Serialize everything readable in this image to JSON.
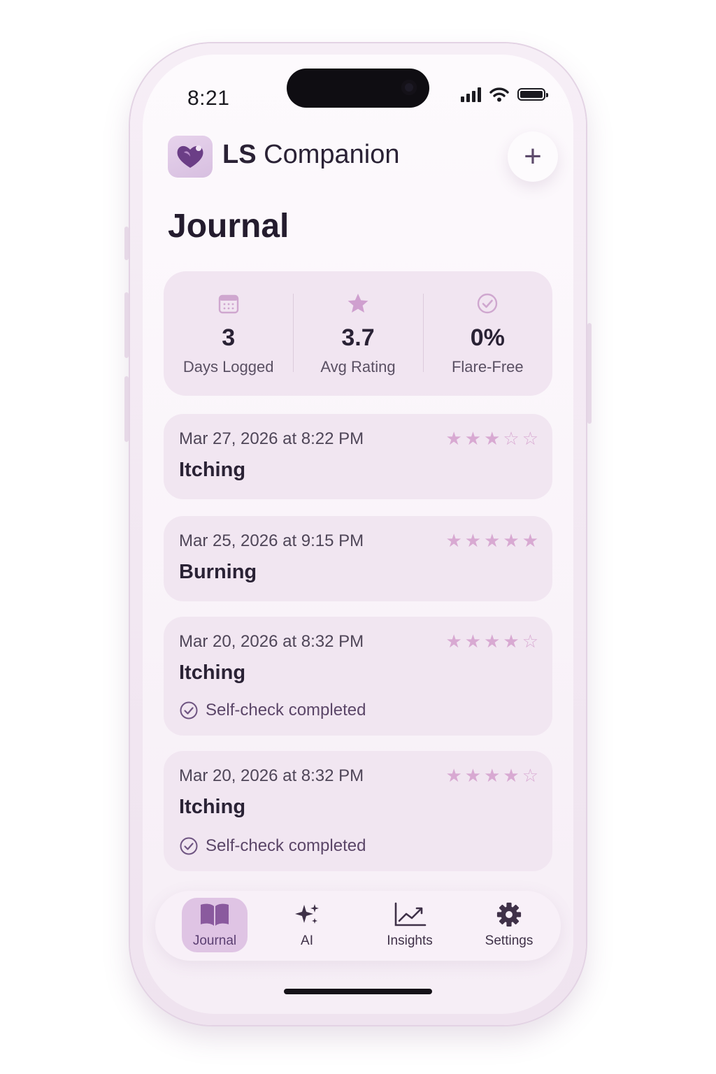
{
  "status_bar": {
    "time": "8:21"
  },
  "header": {
    "app_name_bold": "LS",
    "app_name_rest": "Companion",
    "add_button_label": "+"
  },
  "page": {
    "title": "Journal"
  },
  "stats": [
    {
      "icon": "calendar-icon",
      "value": "3",
      "label": "Days Logged"
    },
    {
      "icon": "star-icon",
      "value": "3.7",
      "label": "Avg Rating"
    },
    {
      "icon": "check-circle-icon",
      "value": "0%",
      "label": "Flare-Free"
    }
  ],
  "entries": [
    {
      "date": "Mar 27, 2026 at 8:22 PM",
      "symptom": "Itching",
      "rating": 3,
      "self_check": ""
    },
    {
      "date": "Mar 25, 2026 at 9:15 PM",
      "symptom": "Burning",
      "rating": 5,
      "self_check": ""
    },
    {
      "date": "Mar 20, 2026 at 8:32 PM",
      "symptom": "Itching",
      "rating": 4,
      "self_check": "Self-check completed"
    },
    {
      "date": "Mar 20, 2026 at 8:32 PM",
      "symptom": "Itching",
      "rating": 4,
      "self_check": "Self-check completed"
    }
  ],
  "tabs": [
    {
      "label": "Journal",
      "icon": "book-icon",
      "active": true
    },
    {
      "label": "AI",
      "icon": "sparkles-icon",
      "active": false
    },
    {
      "label": "Insights",
      "icon": "chart-icon",
      "active": false
    },
    {
      "label": "Settings",
      "icon": "gear-icon",
      "active": false
    }
  ],
  "colors": {
    "accent": "#8a5a9e",
    "star_filled": "#d8a9d2",
    "card_bg": "#f1e6f1"
  }
}
